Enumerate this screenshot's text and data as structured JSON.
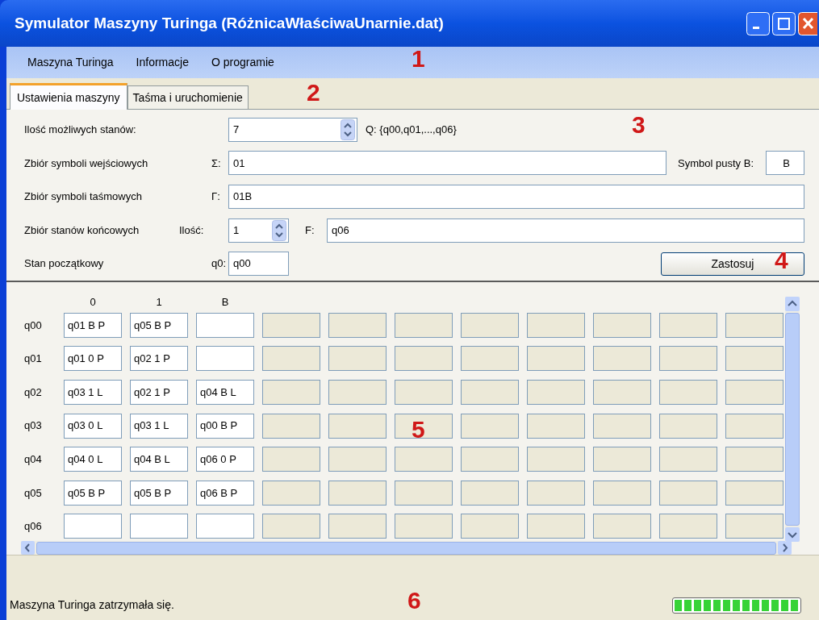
{
  "window": {
    "title": "Symulator Maszyny Turinga (RóżnicaWłaściwaUnarnie.dat)"
  },
  "menu": [
    "Maszyna Turinga",
    "Informacje",
    "O programie"
  ],
  "tabs": [
    {
      "label": "Ustawienia maszyny",
      "selected": true
    },
    {
      "label": "Taśma i uruchomienie",
      "selected": false
    }
  ],
  "settings": {
    "states_label": "Ilość możliwych stanów:",
    "states_value": "7",
    "states_set": "Q: {q00,q01,...,q06}",
    "input_label": "Zbiór symboli wejściowych",
    "input_symbol": "Σ:",
    "input_value": "01",
    "blank_label": "Symbol pusty B:",
    "blank_value": "B",
    "tape_label": "Zbiór symboli taśmowych",
    "tape_symbol": "Γ:",
    "tape_value": "01B",
    "final_label": "Zbiór stanów końcowych",
    "final_count_label": "Ilość:",
    "final_count": "1",
    "final_symbol": "F:",
    "final_value": "q06",
    "start_label": "Stan początkowy",
    "start_symbol": "q0:",
    "start_value": "q00",
    "apply_button": "Zastosuj"
  },
  "table": {
    "columns": [
      {
        "label": "0",
        "disabled": false
      },
      {
        "label": "1",
        "disabled": false
      },
      {
        "label": "B",
        "disabled": false
      },
      {
        "disabled": true
      },
      {
        "disabled": true
      },
      {
        "disabled": true
      },
      {
        "disabled": true
      },
      {
        "disabled": true
      },
      {
        "disabled": true
      },
      {
        "disabled": true
      },
      {
        "disabled": true
      }
    ],
    "rows": [
      {
        "state": "q00",
        "cells": [
          {
            "value": "q01 B P"
          },
          {
            "value": "q05 B P"
          },
          {}
        ]
      },
      {
        "state": "q01",
        "cells": [
          {
            "value": "q01 0 P"
          },
          {
            "value": "q02 1 P"
          },
          {}
        ]
      },
      {
        "state": "q02",
        "cells": [
          {
            "value": "q03 1 L"
          },
          {
            "value": "q02 1 P"
          },
          {
            "value": "q04 B L"
          }
        ]
      },
      {
        "state": "q03",
        "cells": [
          {
            "value": "q03 0 L"
          },
          {
            "value": "q03 1 L"
          },
          {
            "value": "q00 B P"
          }
        ]
      },
      {
        "state": "q04",
        "cells": [
          {
            "value": "q04 0 L"
          },
          {
            "value": "q04 B L"
          },
          {
            "value": "q06 0 P"
          }
        ]
      },
      {
        "state": "q05",
        "cells": [
          {
            "value": "q05 B P"
          },
          {
            "value": "q05 B P"
          },
          {
            "value": "q06 B P"
          }
        ]
      },
      {
        "state": "q06",
        "cells": [
          {},
          {},
          {}
        ]
      }
    ]
  },
  "status_bar": {
    "text": "Maszyna Turinga zatrzymała się.",
    "progress": {
      "level": 1
    }
  },
  "annotations": [
    "1",
    "2",
    "3",
    "4",
    "5",
    "6"
  ]
}
